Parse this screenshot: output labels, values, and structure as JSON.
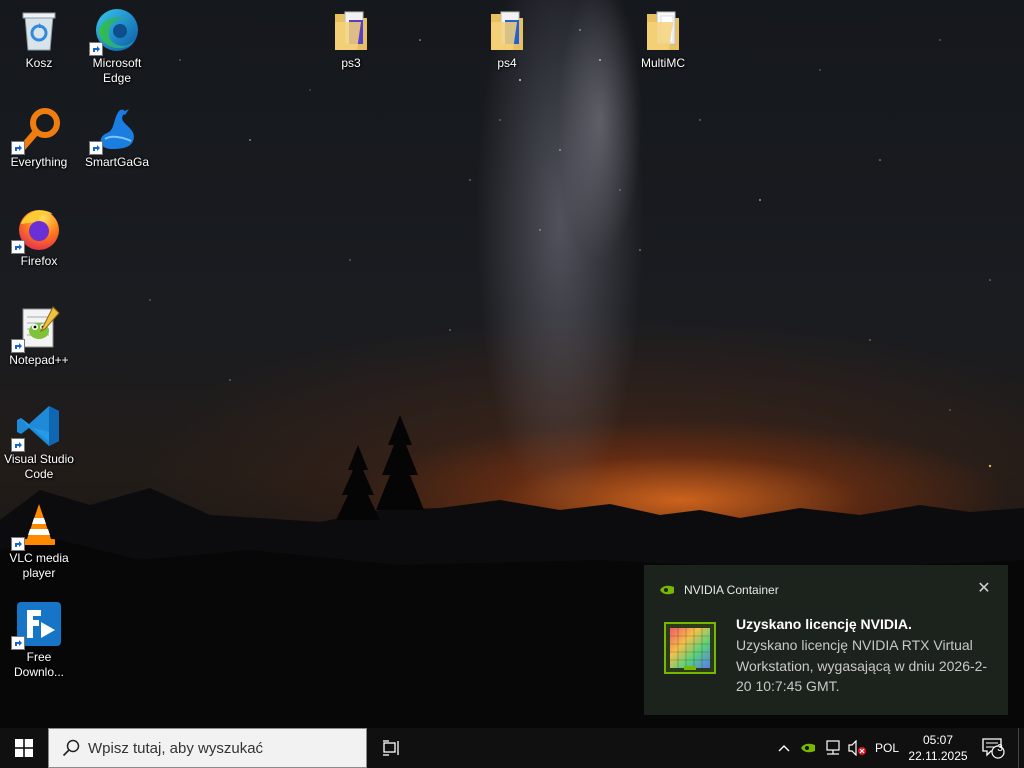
{
  "desktop": {
    "icons": [
      {
        "label": "Kosz",
        "icon": "recycle-bin-icon"
      },
      {
        "label": "Microsoft Edge",
        "icon": "edge-icon"
      },
      {
        "label": "Everything",
        "icon": "everything-search-icon"
      },
      {
        "label": "SmartGaGa",
        "icon": "smartgaga-icon"
      },
      {
        "label": "Firefox",
        "icon": "firefox-icon"
      },
      {
        "label": "Notepad++",
        "icon": "notepadpp-icon"
      },
      {
        "label": "Visual Studio Code",
        "icon": "vscode-icon"
      },
      {
        "label": "VLC media player",
        "icon": "vlc-icon"
      },
      {
        "label": "Free Downlo...",
        "icon": "free-download-manager-icon"
      },
      {
        "label": "ps3",
        "icon": "folder-icon"
      },
      {
        "label": "ps4",
        "icon": "folder-icon"
      },
      {
        "label": "MultiMC",
        "icon": "folder-icon"
      }
    ]
  },
  "notification": {
    "app_name": "NVIDIA Container",
    "title": "Uzyskano licencję NVIDIA.",
    "body": "Uzyskano licencję NVIDIA RTX Virtual Workstation, wygasającą w dniu 2026-2-20 10:7:45 GMT.",
    "close_icon": "close-icon"
  },
  "taskbar": {
    "search_placeholder": "Wpisz tutaj, aby wyszukać",
    "language": "POL",
    "time": "05:07",
    "date": "22.11.2025",
    "notification_count": "3"
  },
  "colors": {
    "taskbar": "#101010",
    "toast_bg": "#1e261e",
    "nvidia_green": "#76b900"
  }
}
